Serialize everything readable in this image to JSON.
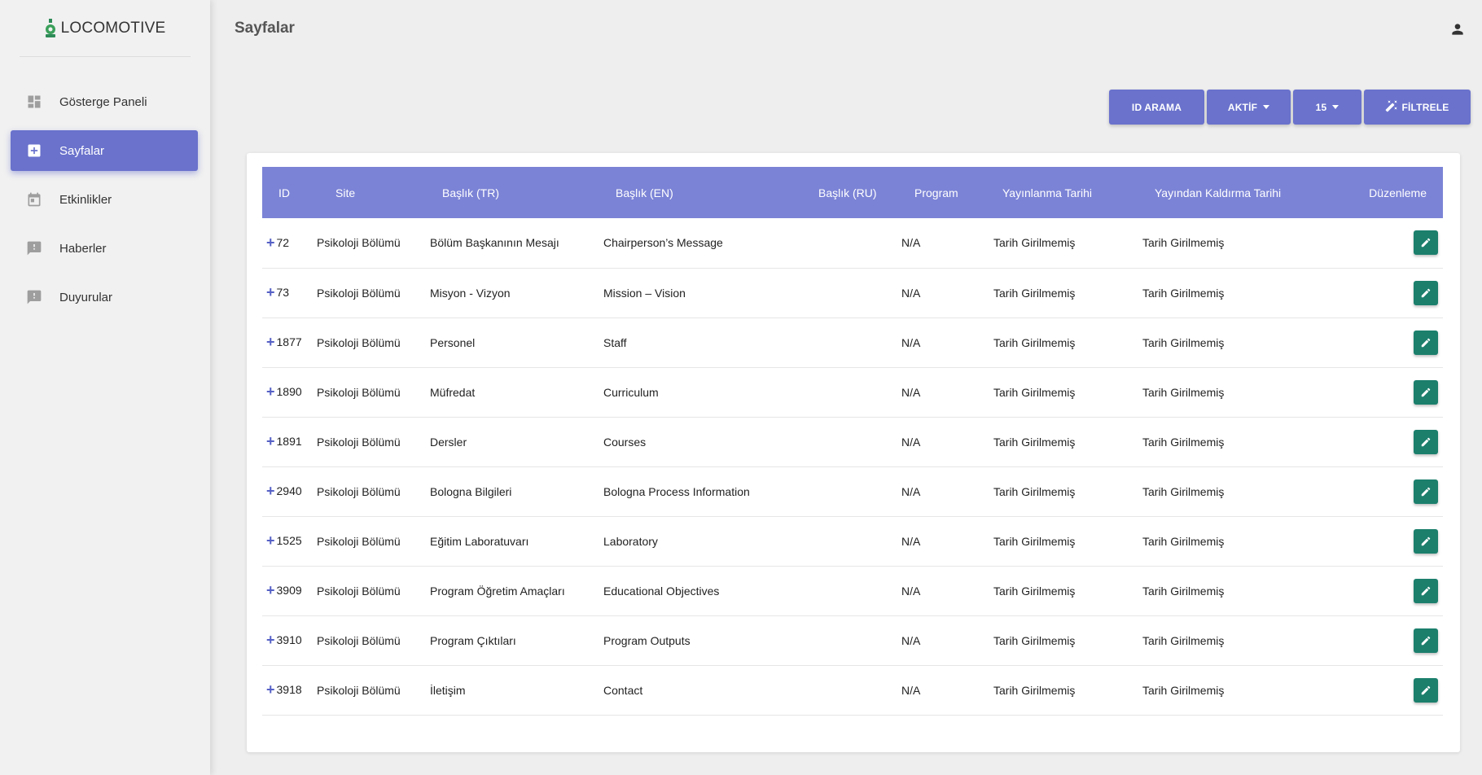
{
  "app": {
    "brand": "LOCOMOTIVE"
  },
  "sidebar": {
    "items": [
      {
        "label": "Gösterge Paneli",
        "icon": "dashboard-icon",
        "active": false
      },
      {
        "label": "Sayfalar",
        "icon": "pages-icon",
        "active": true
      },
      {
        "label": "Etkinlikler",
        "icon": "calendar-icon",
        "active": false
      },
      {
        "label": "Haberler",
        "icon": "news-icon",
        "active": false
      },
      {
        "label": "Duyurular",
        "icon": "announcement-icon",
        "active": false
      }
    ]
  },
  "header": {
    "title": "Sayfalar",
    "user_icon": "account-icon"
  },
  "toolbar": {
    "id_search_label": "ID ARAMA",
    "status_label": "AKTİF",
    "page_size_label": "15",
    "filter_label": "FİLTRELE"
  },
  "colors": {
    "accent": "#6a72cc",
    "table_header": "#7b83d6",
    "edit_button": "#1b7f6c"
  },
  "table": {
    "columns": {
      "id": "ID",
      "site": "Site",
      "title_tr": "Başlık (TR)",
      "title_en": "Başlık (EN)",
      "title_ru": "Başlık (RU)",
      "program": "Program",
      "publish_date": "Yayınlanma Tarihi",
      "unpublish_date": "Yayından Kaldırma Tarihi",
      "edit": "Düzenleme"
    },
    "rows": [
      {
        "id": "72",
        "site": "Psikoloji Bölümü",
        "title_tr": "Bölüm Başkanının Mesajı",
        "title_en": "Chairperson’s Message",
        "title_ru": "",
        "program": "N/A",
        "publish_date": "Tarih Girilmemiş",
        "unpublish_date": "Tarih Girilmemiş"
      },
      {
        "id": "73",
        "site": "Psikoloji Bölümü",
        "title_tr": "Misyon - Vizyon",
        "title_en": "Mission – Vision",
        "title_ru": "",
        "program": "N/A",
        "publish_date": "Tarih Girilmemiş",
        "unpublish_date": "Tarih Girilmemiş"
      },
      {
        "id": "1877",
        "site": "Psikoloji Bölümü",
        "title_tr": "Personel",
        "title_en": "Staff",
        "title_ru": "",
        "program": "N/A",
        "publish_date": "Tarih Girilmemiş",
        "unpublish_date": "Tarih Girilmemiş"
      },
      {
        "id": "1890",
        "site": "Psikoloji Bölümü",
        "title_tr": "Müfredat",
        "title_en": "Curriculum",
        "title_ru": "",
        "program": "N/A",
        "publish_date": "Tarih Girilmemiş",
        "unpublish_date": "Tarih Girilmemiş"
      },
      {
        "id": "1891",
        "site": "Psikoloji Bölümü",
        "title_tr": "Dersler",
        "title_en": "Courses",
        "title_ru": "",
        "program": "N/A",
        "publish_date": "Tarih Girilmemiş",
        "unpublish_date": "Tarih Girilmemiş"
      },
      {
        "id": "2940",
        "site": "Psikoloji Bölümü",
        "title_tr": "Bologna Bilgileri",
        "title_en": "Bologna Process Information",
        "title_ru": "",
        "program": "N/A",
        "publish_date": "Tarih Girilmemiş",
        "unpublish_date": "Tarih Girilmemiş"
      },
      {
        "id": "1525",
        "site": "Psikoloji Bölümü",
        "title_tr": "Eğitim Laboratuvarı",
        "title_en": "Laboratory",
        "title_ru": "",
        "program": "N/A",
        "publish_date": "Tarih Girilmemiş",
        "unpublish_date": "Tarih Girilmemiş"
      },
      {
        "id": "3909",
        "site": "Psikoloji Bölümü",
        "title_tr": "Program Öğretim Amaçları",
        "title_en": "Educational Objectives",
        "title_ru": "",
        "program": "N/A",
        "publish_date": "Tarih Girilmemiş",
        "unpublish_date": "Tarih Girilmemiş"
      },
      {
        "id": "3910",
        "site": "Psikoloji Bölümü",
        "title_tr": "Program Çıktıları",
        "title_en": "Program Outputs",
        "title_ru": "",
        "program": "N/A",
        "publish_date": "Tarih Girilmemiş",
        "unpublish_date": "Tarih Girilmemiş"
      },
      {
        "id": "3918",
        "site": "Psikoloji Bölümü",
        "title_tr": "İletişim",
        "title_en": "Contact",
        "title_ru": "",
        "program": "N/A",
        "publish_date": "Tarih Girilmemiş",
        "unpublish_date": "Tarih Girilmemiş"
      }
    ]
  }
}
